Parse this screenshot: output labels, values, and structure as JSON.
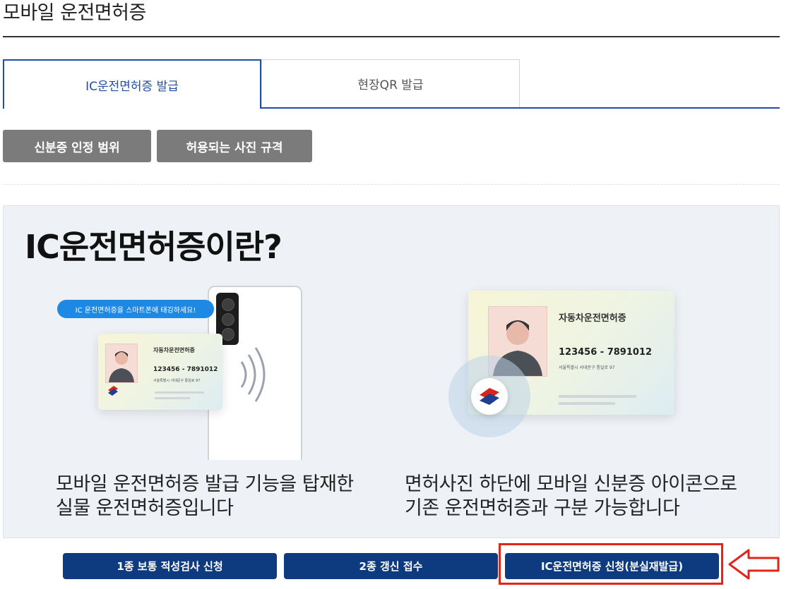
{
  "page": {
    "title": "모바일 운전면허증"
  },
  "tabs": [
    {
      "label": "IC운전면허증 발급",
      "active": true
    },
    {
      "label": "현장QR 발급",
      "active": false
    }
  ],
  "info_buttons": [
    {
      "label": "신분증 인정 범위"
    },
    {
      "label": "허용되는 사진 규격"
    }
  ],
  "intro": {
    "heading": "IC운전면허증이란?",
    "left_caption": [
      "모바일 운전면허증 발급 기능을 탑재한",
      "실물 운전면허증입니다"
    ],
    "right_caption": [
      "면허사진 하단에 모바일 신분증 아이콘으로",
      "기존 운전면허증과 구분 가능합니다"
    ],
    "tag_bubble": "IC 운전면허증을 스마트폰에 태깅하세요!",
    "card": {
      "title": "자동차운전면허증",
      "number": "123456 - 7891012",
      "address": "서울특별시 서대문구 통일로 97"
    }
  },
  "action_buttons": [
    {
      "label": "1종 보통 적성검사 신청"
    },
    {
      "label": "2종 갱신 접수"
    },
    {
      "label": "IC운전면허증 신청(분실재발급)"
    }
  ],
  "colors": {
    "accent": "#1f4fa5",
    "action_button": "#0e3b7f",
    "info_button": "#7b7b7b",
    "highlight": "#e1251b",
    "panel_bg": "#eef2f6"
  }
}
